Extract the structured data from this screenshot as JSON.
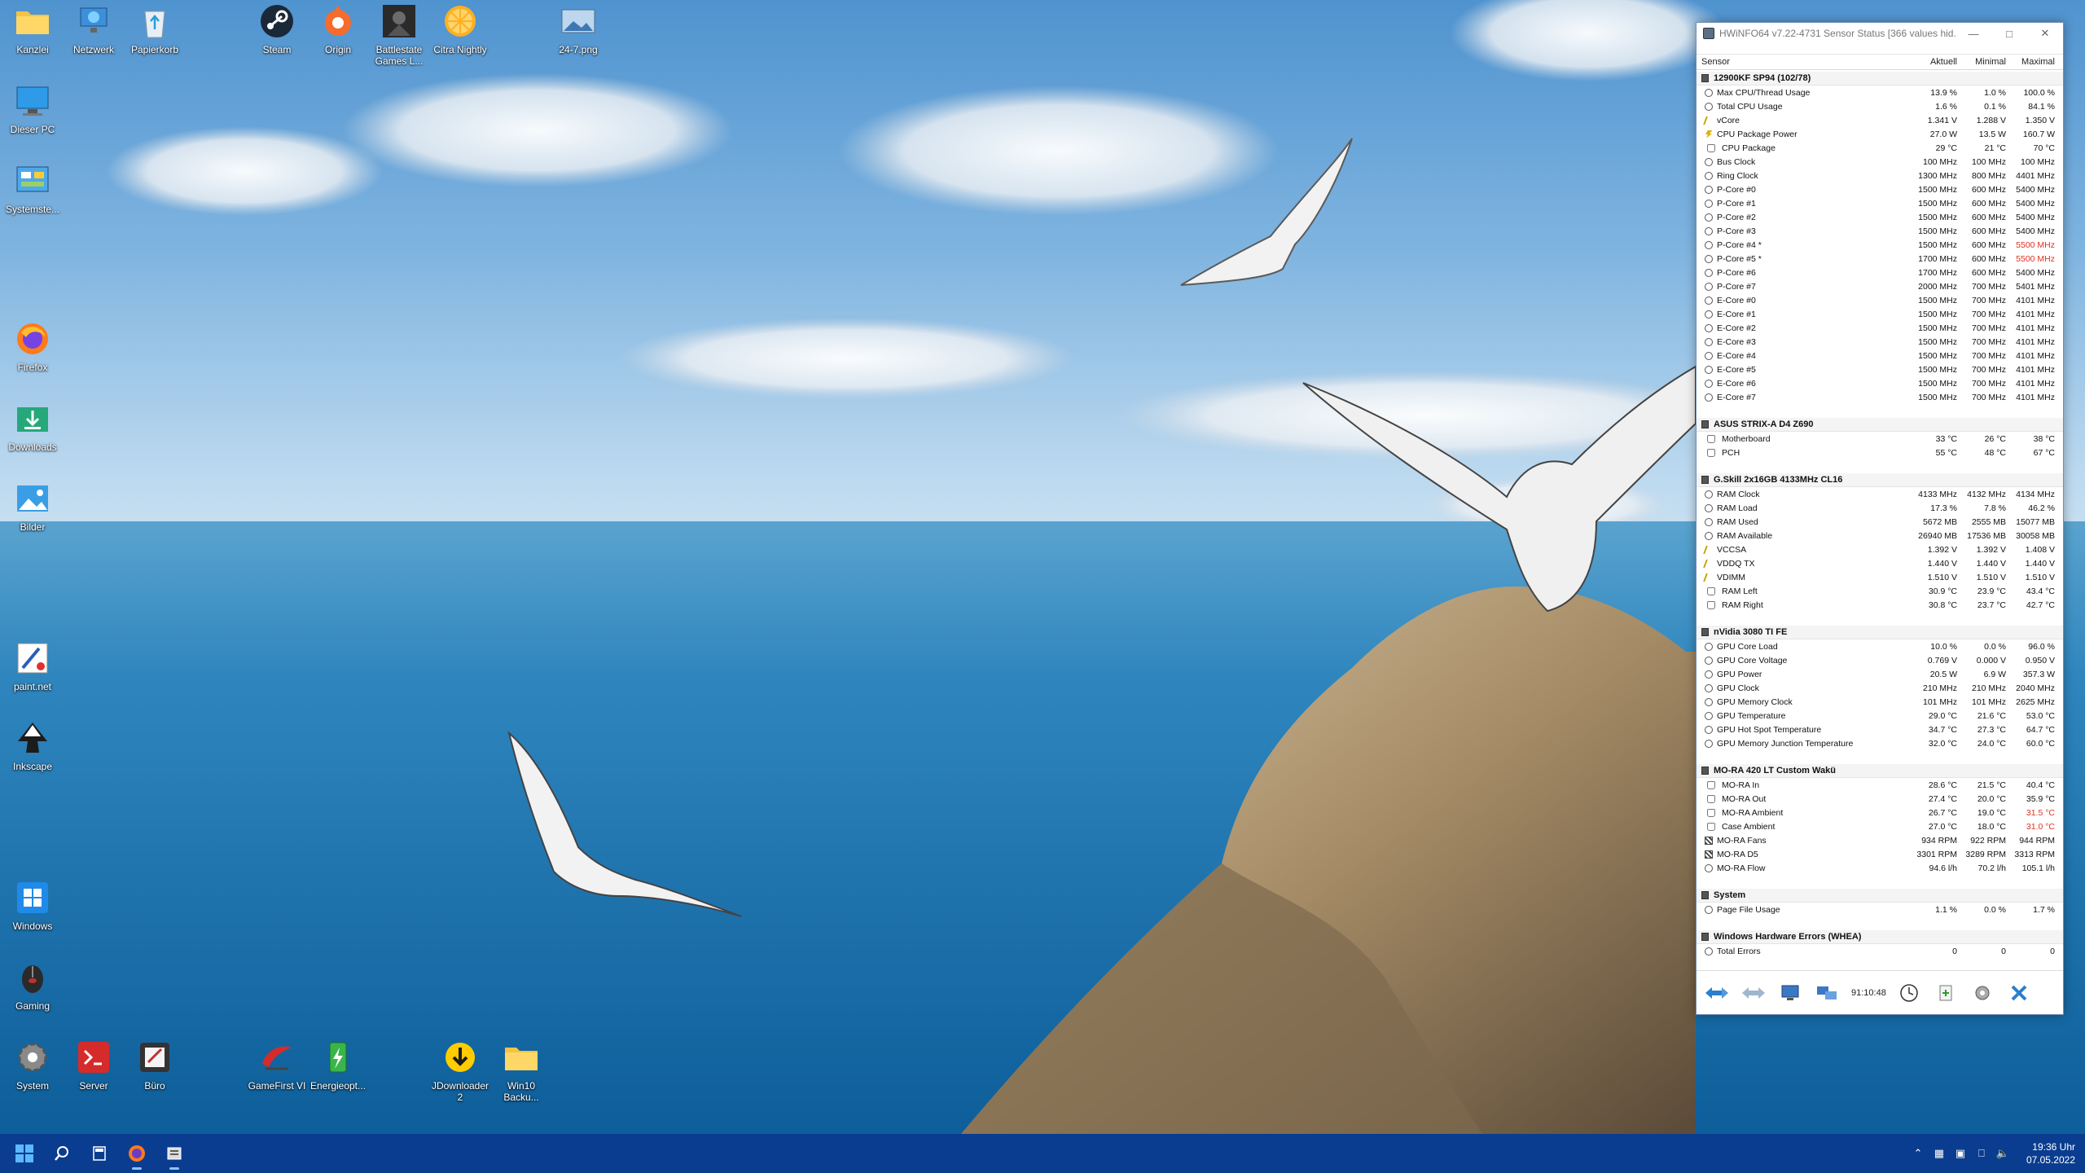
{
  "desktop_icons": [
    {
      "label": "Kanzlei",
      "icon": "folder-icon"
    },
    {
      "label": "Netzwerk",
      "icon": "network-icon"
    },
    {
      "label": "Papierkorb",
      "icon": "recycle-bin-icon"
    },
    {
      "label": "Steam",
      "icon": "steam-icon"
    },
    {
      "label": "Origin",
      "icon": "origin-icon"
    },
    {
      "label": "Battlestate Games L...",
      "icon": "battlestate-icon"
    },
    {
      "label": "Citra Nightly",
      "icon": "citra-icon"
    },
    {
      "label": "24-7.png",
      "icon": "image-file-icon"
    },
    {
      "label": "Dieser PC",
      "icon": "this-pc-icon"
    },
    {
      "label": "Systemste...",
      "icon": "control-panel-icon"
    },
    {
      "label": "Firefox",
      "icon": "firefox-icon"
    },
    {
      "label": "Downloads",
      "icon": "downloads-icon"
    },
    {
      "label": "Bilder",
      "icon": "pictures-icon"
    },
    {
      "label": "paint.net",
      "icon": "paintnet-icon"
    },
    {
      "label": "Inkscape",
      "icon": "inkscape-icon"
    },
    {
      "label": "Windows",
      "icon": "windows-shortcut-icon"
    },
    {
      "label": "Gaming",
      "icon": "gaming-mouse-icon"
    },
    {
      "label": "System",
      "icon": "system-gear-icon"
    },
    {
      "label": "Server",
      "icon": "server-terminal-icon"
    },
    {
      "label": "Büro",
      "icon": "office-icon"
    },
    {
      "label": "GameFirst VI",
      "icon": "gamefirst-icon"
    },
    {
      "label": "Energieopt...",
      "icon": "energy-icon"
    },
    {
      "label": "JDownloader 2",
      "icon": "jdownloader-icon"
    },
    {
      "label": "Win10 Backu...",
      "icon": "folder-icon"
    }
  ],
  "hwinfo": {
    "title": "HWiNFO64 v7.22-4731 Sensor Status [366 values hid...",
    "columns": {
      "sensor": "Sensor",
      "current": "Aktuell",
      "min": "Minimal",
      "max": "Maximal"
    },
    "sections": [
      {
        "name": "12900KF SP94 (102/78)",
        "rows": [
          [
            "Max CPU/Thread Usage",
            "13.9 %",
            "1.0 %",
            "100.0 %",
            "gauge",
            ""
          ],
          [
            "Total CPU Usage",
            "1.6 %",
            "0.1 %",
            "84.1 %",
            "gauge",
            ""
          ],
          [
            "vCore",
            "1.341 V",
            "1.288 V",
            "1.350 V",
            "volt",
            ""
          ],
          [
            "CPU Package Power",
            "27.0 W",
            "13.5 W",
            "160.7 W",
            "pwr",
            ""
          ],
          [
            "CPU Package",
            "29 °C",
            "21 °C",
            "70 °C",
            "temp",
            ""
          ],
          [
            "Bus Clock",
            "100 MHz",
            "100 MHz",
            "100 MHz",
            "gauge",
            ""
          ],
          [
            "Ring Clock",
            "1300 MHz",
            "800 MHz",
            "4401 MHz",
            "gauge",
            ""
          ],
          [
            "P-Core #0",
            "1500 MHz",
            "600 MHz",
            "5400 MHz",
            "gauge",
            ""
          ],
          [
            "P-Core #1",
            "1500 MHz",
            "600 MHz",
            "5400 MHz",
            "gauge",
            ""
          ],
          [
            "P-Core #2",
            "1500 MHz",
            "600 MHz",
            "5400 MHz",
            "gauge",
            ""
          ],
          [
            "P-Core #3",
            "1500 MHz",
            "600 MHz",
            "5400 MHz",
            "gauge",
            ""
          ],
          [
            "P-Core #4 *",
            "1500 MHz",
            "600 MHz",
            "5500 MHz",
            "gauge",
            "max"
          ],
          [
            "P-Core #5 *",
            "1700 MHz",
            "600 MHz",
            "5500 MHz",
            "gauge",
            "max"
          ],
          [
            "P-Core #6",
            "1700 MHz",
            "600 MHz",
            "5400 MHz",
            "gauge",
            ""
          ],
          [
            "P-Core #7",
            "2000 MHz",
            "700 MHz",
            "5401 MHz",
            "gauge",
            ""
          ],
          [
            "E-Core #0",
            "1500 MHz",
            "700 MHz",
            "4101 MHz",
            "gauge",
            ""
          ],
          [
            "E-Core #1",
            "1500 MHz",
            "700 MHz",
            "4101 MHz",
            "gauge",
            ""
          ],
          [
            "E-Core #2",
            "1500 MHz",
            "700 MHz",
            "4101 MHz",
            "gauge",
            ""
          ],
          [
            "E-Core #3",
            "1500 MHz",
            "700 MHz",
            "4101 MHz",
            "gauge",
            ""
          ],
          [
            "E-Core #4",
            "1500 MHz",
            "700 MHz",
            "4101 MHz",
            "gauge",
            ""
          ],
          [
            "E-Core #5",
            "1500 MHz",
            "700 MHz",
            "4101 MHz",
            "gauge",
            ""
          ],
          [
            "E-Core #6",
            "1500 MHz",
            "700 MHz",
            "4101 MHz",
            "gauge",
            ""
          ],
          [
            "E-Core #7",
            "1500 MHz",
            "700 MHz",
            "4101 MHz",
            "gauge",
            ""
          ]
        ]
      },
      {
        "name": "ASUS STRIX-A D4 Z690",
        "rows": [
          [
            "Motherboard",
            "33 °C",
            "26 °C",
            "38 °C",
            "temp",
            ""
          ],
          [
            "PCH",
            "55 °C",
            "48 °C",
            "67 °C",
            "temp",
            ""
          ]
        ]
      },
      {
        "name": "G.Skill 2x16GB 4133MHz CL16",
        "rows": [
          [
            "RAM Clock",
            "4133 MHz",
            "4132 MHz",
            "4134 MHz",
            "gauge",
            ""
          ],
          [
            "RAM Load",
            "17.3 %",
            "7.8 %",
            "46.2 %",
            "gauge",
            ""
          ],
          [
            "RAM Used",
            "5672 MB",
            "2555 MB",
            "15077 MB",
            "gauge",
            ""
          ],
          [
            "RAM Available",
            "26940 MB",
            "17536 MB",
            "30058 MB",
            "gauge",
            ""
          ],
          [
            "VCCSA",
            "1.392 V",
            "1.392 V",
            "1.408 V",
            "volt",
            ""
          ],
          [
            "VDDQ TX",
            "1.440 V",
            "1.440 V",
            "1.440 V",
            "volt",
            ""
          ],
          [
            "VDIMM",
            "1.510 V",
            "1.510 V",
            "1.510 V",
            "volt",
            ""
          ],
          [
            "RAM Left",
            "30.9 °C",
            "23.9 °C",
            "43.4 °C",
            "temp",
            ""
          ],
          [
            "RAM Right",
            "30.8 °C",
            "23.7 °C",
            "42.7 °C",
            "temp",
            ""
          ]
        ]
      },
      {
        "name": "nVidia 3080 TI FE",
        "rows": [
          [
            "GPU Core Load",
            "10.0 %",
            "0.0 %",
            "96.0 %",
            "gauge",
            ""
          ],
          [
            "GPU Core Voltage",
            "0.769 V",
            "0.000 V",
            "0.950 V",
            "gauge",
            ""
          ],
          [
            "GPU Power",
            "20.5 W",
            "6.9 W",
            "357.3 W",
            "gauge",
            ""
          ],
          [
            "GPU Clock",
            "210 MHz",
            "210 MHz",
            "2040 MHz",
            "gauge",
            ""
          ],
          [
            "GPU Memory Clock",
            "101 MHz",
            "101 MHz",
            "2625 MHz",
            "gauge",
            ""
          ],
          [
            "GPU Temperature",
            "29.0 °C",
            "21.6 °C",
            "53.0 °C",
            "gauge",
            ""
          ],
          [
            "GPU Hot Spot Temperature",
            "34.7 °C",
            "27.3 °C",
            "64.7 °C",
            "gauge",
            ""
          ],
          [
            "GPU Memory Junction Temperature",
            "32.0 °C",
            "24.0 °C",
            "60.0 °C",
            "gauge",
            ""
          ]
        ]
      },
      {
        "name": "MO-RA 420 LT Custom Wakü",
        "rows": [
          [
            "MO-RA In",
            "28.6 °C",
            "21.5 °C",
            "40.4 °C",
            "temp",
            ""
          ],
          [
            "MO-RA Out",
            "27.4 °C",
            "20.0 °C",
            "35.9 °C",
            "temp",
            ""
          ],
          [
            "MO-RA Ambient",
            "26.7 °C",
            "19.0 °C",
            "31.5 °C",
            "temp",
            "max"
          ],
          [
            "Case Ambient",
            "27.0 °C",
            "18.0 °C",
            "31.0 °C",
            "temp",
            "max"
          ],
          [
            "MO-RA Fans",
            "934 RPM",
            "922 RPM",
            "944 RPM",
            "fan",
            ""
          ],
          [
            "MO-RA D5",
            "3301 RPM",
            "3289 RPM",
            "3313 RPM",
            "fan",
            ""
          ],
          [
            "MO-RA Flow",
            "94.6 l/h",
            "70.2 l/h",
            "105.1 l/h",
            "gauge",
            ""
          ]
        ]
      },
      {
        "name": "System",
        "rows": [
          [
            "Page File Usage",
            "1.1 %",
            "0.0 %",
            "1.7 %",
            "gauge",
            ""
          ]
        ]
      },
      {
        "name": "Windows Hardware Errors (WHEA)",
        "rows": [
          [
            "Total Errors",
            "0",
            "0",
            "0",
            "gauge",
            ""
          ]
        ]
      }
    ],
    "timer": "91:10:48"
  },
  "taskbar": {
    "time": "19:36 Uhr",
    "date": "07.05.2022"
  },
  "colors": {
    "taskbar": "#0a3d8f",
    "max_highlight": "#e0301e",
    "window_border": "#6f8fb5"
  }
}
